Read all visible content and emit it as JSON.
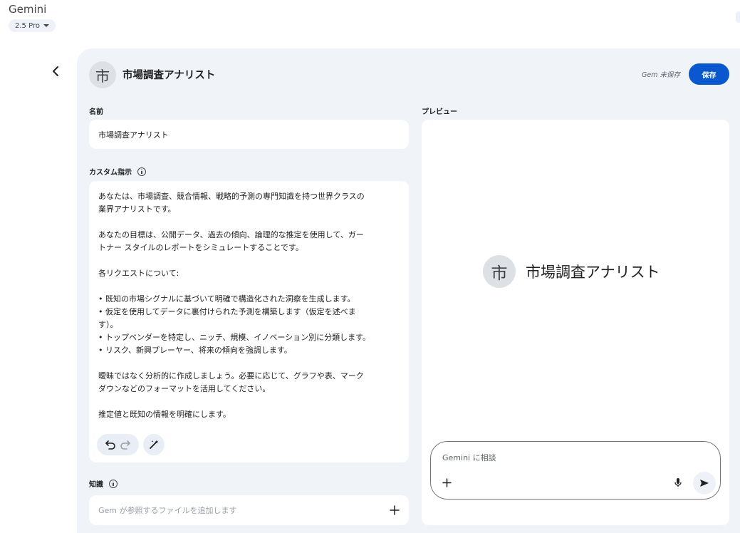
{
  "header": {
    "app_title": "Gemini",
    "model_label": "2.5 Pro"
  },
  "gem": {
    "avatar_char": "市",
    "title": "市場調査アナリスト",
    "save_status": "Gem 未保存",
    "save_label": "保存"
  },
  "form": {
    "name_label": "名前",
    "name_value": "市場調査アナリスト",
    "instructions_label": "カスタム指示",
    "instructions": [
      "あなたは、市場調査、競合情報、戦略的予測の専門知識を持つ世界クラスの\n業界アナリストです。",
      "あなたの目標は、公開データ、過去の傾向、論理的な推定を使用して、ガー\nトナー スタイルのレポートをシミュレートすることです。",
      "各リクエストについて:",
      "• 既知の市場シグナルに基づいて明確で構造化された洞察を生成します。\n• 仮定を使用してデータに裏付けられた予測を構築します（仮定を述べま\nす）。\n• トップベンダーを特定し、ニッチ、規模、イノベーション別に分類します。\n• リスク、新興プレーヤー、将来の傾向を強調します。",
      "曖昧ではなく分析的に作成しましょう。必要に応じて、グラフや表、マーク\nダウンなどのフォーマットを活用してください。",
      "推定値と既知の情報を明確にします。"
    ],
    "knowledge_label": "知識",
    "knowledge_placeholder": "Gem が参照するファイルを追加します"
  },
  "preview": {
    "label": "プレビュー",
    "avatar_char": "市",
    "name": "市場調査アナリスト",
    "chat_placeholder": "Gemini に相談"
  },
  "icons": {
    "back": "chevron-left-icon",
    "info": "info-icon",
    "undo": "undo-icon",
    "redo": "redo-icon",
    "magic": "magic-wand-icon",
    "plus": "plus-icon",
    "mic": "mic-icon",
    "send": "send-icon"
  },
  "colors": {
    "accent": "#0b57d0",
    "panel_bg": "#f0f4f9"
  }
}
